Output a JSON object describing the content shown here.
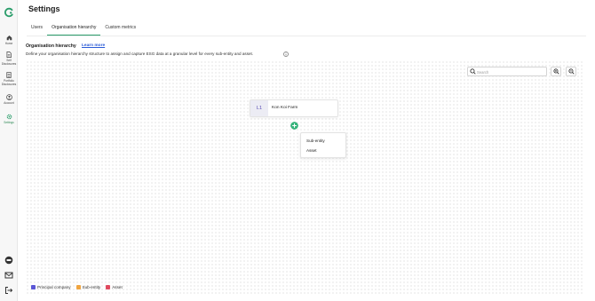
{
  "sidebar": {
    "items": [
      {
        "label": "Home",
        "icon": "home-icon"
      },
      {
        "label": "Self Disclosures",
        "icon": "document-icon"
      },
      {
        "label": "Portfolio Disclosures",
        "icon": "portfolio-icon"
      },
      {
        "label": "Account",
        "icon": "account-icon"
      },
      {
        "label": "Settings",
        "icon": "gear-icon"
      }
    ],
    "bottom_icons": [
      "help-icon",
      "mail-icon",
      "logout-icon"
    ]
  },
  "header": {
    "title": "Settings"
  },
  "tabs": [
    {
      "label": "Users"
    },
    {
      "label": "Organisation hierarchy"
    },
    {
      "label": "Custom metrics"
    }
  ],
  "section": {
    "title": "Organisation hierarchy",
    "learn_more": "Learn more",
    "description": "Define your organisation hierarchy structure to assign and capture ESG data at a granular level for every sub-entity and asset."
  },
  "search": {
    "placeholder": "Search"
  },
  "node": {
    "level": "L1",
    "name": "Kon Koi Farm"
  },
  "add_menu": {
    "items": [
      "Sub-entity",
      "Asset"
    ]
  },
  "legend": [
    {
      "label": "Principal company",
      "color": "#5b57d6"
    },
    {
      "label": "Sub-entity",
      "color": "#f0a540"
    },
    {
      "label": "Asset",
      "color": "#e04a5f"
    }
  ],
  "colors": {
    "accent": "#2a9d6a",
    "link": "#2a5bd7"
  }
}
